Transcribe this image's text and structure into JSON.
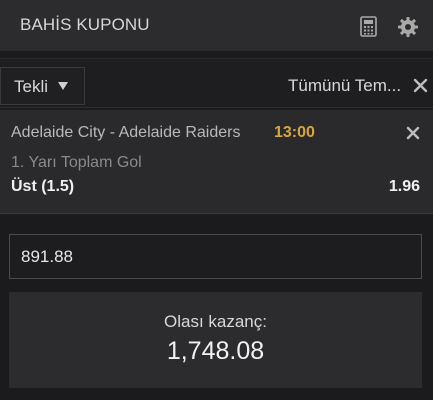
{
  "header": {
    "title": "BAHİS KUPONU",
    "icons": [
      "calculator-icon",
      "gear-icon"
    ]
  },
  "toolbar": {
    "bet_type": "Tekli",
    "clear_all": "Tümünü Tem..."
  },
  "bet": {
    "match": "Adelaide City - Adelaide Raiders",
    "time": "13:00",
    "market": "1. Yarı Toplam Gol",
    "selection": "Üst (1.5)",
    "odds": "1.96"
  },
  "stake": {
    "value": "891.88"
  },
  "winnings": {
    "label": "Olası kazanç:",
    "amount": "1,748.08"
  },
  "colors": {
    "accent_time": "#d9a53d",
    "background": "#1b1b1d",
    "panel": "#2c2c2e"
  }
}
